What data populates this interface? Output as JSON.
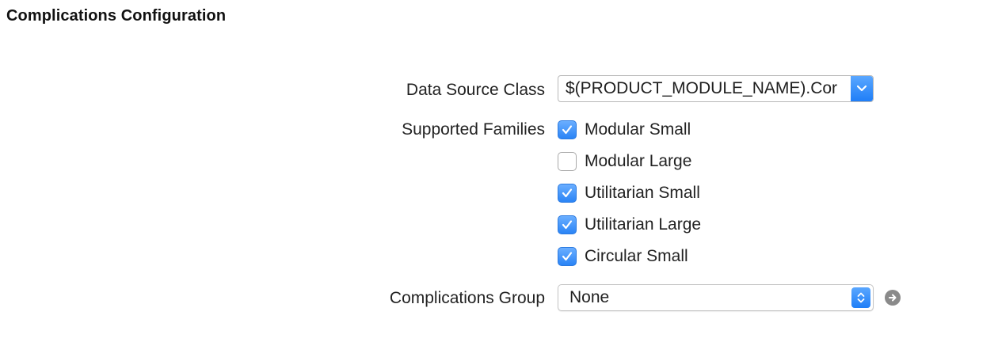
{
  "section": {
    "title": "Complications Configuration"
  },
  "data_source": {
    "label": "Data Source Class",
    "value": "$(PRODUCT_MODULE_NAME).Cor",
    "control_icon": "chevron-down-icon"
  },
  "families": {
    "label": "Supported Families",
    "items": [
      {
        "label": "Modular Small",
        "checked": true
      },
      {
        "label": "Modular Large",
        "checked": false
      },
      {
        "label": "Utilitarian Small",
        "checked": true
      },
      {
        "label": "Utilitarian Large",
        "checked": true
      },
      {
        "label": "Circular Small",
        "checked": true
      }
    ]
  },
  "group": {
    "label": "Complications Group",
    "value": "None",
    "control_icon": "up-down-arrows-icon",
    "navigate_icon": "arrow-right-circle-icon"
  },
  "colors": {
    "accent": "#2a84f6"
  }
}
